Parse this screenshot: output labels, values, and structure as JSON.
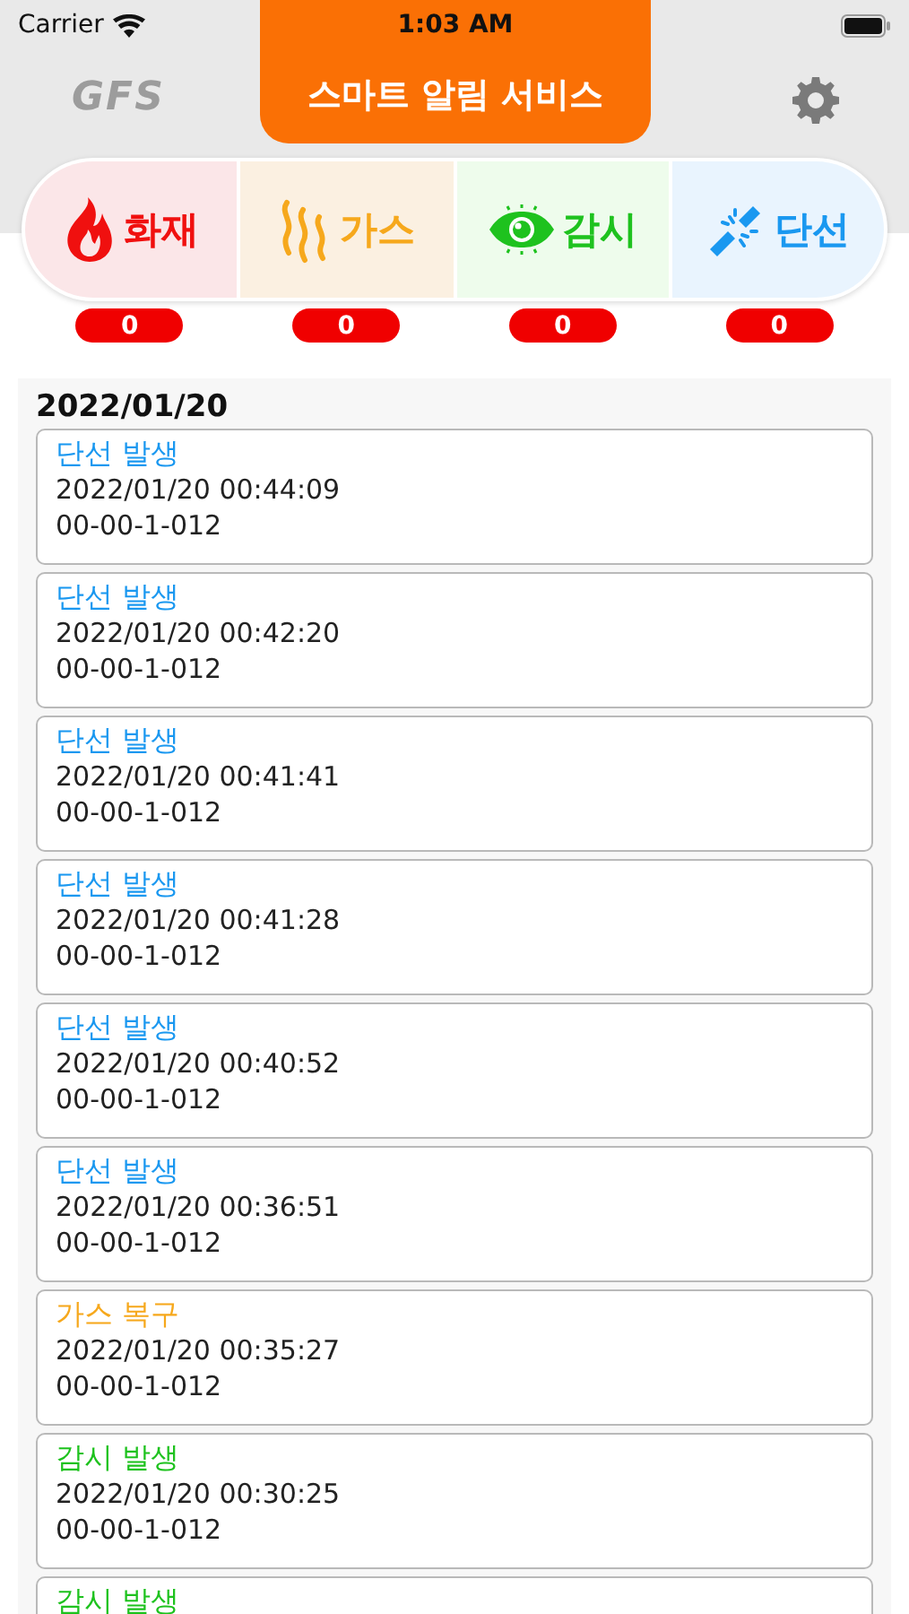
{
  "status_bar": {
    "carrier": "Carrier",
    "time": "1:03 AM"
  },
  "header": {
    "logo": "GFS",
    "title": "스마트 알림 서비스"
  },
  "categories": [
    {
      "kind": "fire",
      "label": "화재",
      "count": "0"
    },
    {
      "kind": "gas",
      "label": "가스",
      "count": "0"
    },
    {
      "kind": "watch",
      "label": "감시",
      "count": "0"
    },
    {
      "kind": "cut",
      "label": "단선",
      "count": "0"
    }
  ],
  "log": {
    "date": "2022/01/20",
    "events": [
      {
        "kind": "cut",
        "title": "단선 발생",
        "time": "2022/01/20 00:44:09",
        "device": "00-00-1-012"
      },
      {
        "kind": "cut",
        "title": "단선 발생",
        "time": "2022/01/20 00:42:20",
        "device": "00-00-1-012"
      },
      {
        "kind": "cut",
        "title": "단선 발생",
        "time": "2022/01/20 00:41:41",
        "device": "00-00-1-012"
      },
      {
        "kind": "cut",
        "title": "단선 발생",
        "time": "2022/01/20 00:41:28",
        "device": "00-00-1-012"
      },
      {
        "kind": "cut",
        "title": "단선 발생",
        "time": "2022/01/20 00:40:52",
        "device": "00-00-1-012"
      },
      {
        "kind": "cut",
        "title": "단선 발생",
        "time": "2022/01/20 00:36:51",
        "device": "00-00-1-012"
      },
      {
        "kind": "gas",
        "title": "가스 복구",
        "time": "2022/01/20 00:35:27",
        "device": "00-00-1-012"
      },
      {
        "kind": "watch",
        "title": "감시 발생",
        "time": "2022/01/20 00:30:25",
        "device": "00-00-1-012"
      },
      {
        "kind": "watch",
        "title": "감시 발생"
      }
    ]
  }
}
